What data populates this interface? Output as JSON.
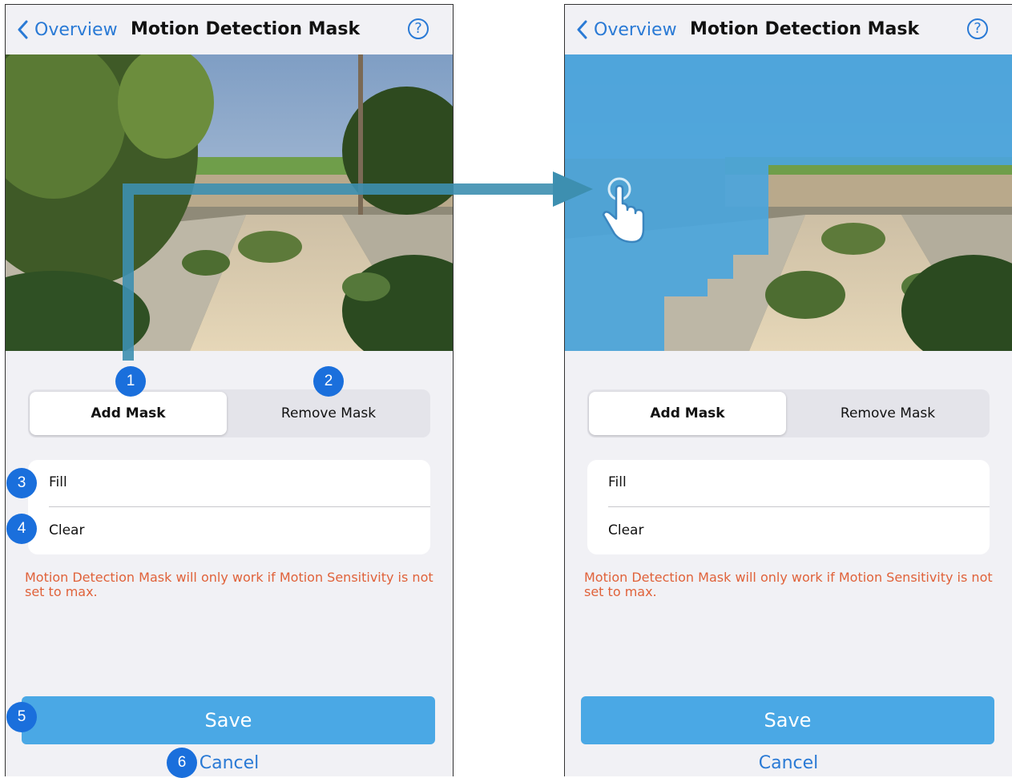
{
  "nav": {
    "back_label": "Overview",
    "title": "Motion Detection Mask",
    "help_glyph": "?"
  },
  "segments": {
    "add_mask": "Add Mask",
    "remove_mask": "Remove Mask"
  },
  "options": {
    "fill": "Fill",
    "clear": "Clear"
  },
  "warning": "Motion Detection Mask will only work if Motion Sensitivity is not set to max.",
  "actions": {
    "save": "Save",
    "cancel": "Cancel"
  },
  "callouts": [
    "1",
    "2",
    "3",
    "4",
    "5",
    "6"
  ],
  "colors": {
    "accent": "#2a7ad5",
    "button": "#4aa8e5",
    "warning": "#e0623a",
    "badge": "#1a6fdc",
    "mask_overlay": "#4ba5dc",
    "arrow": "#3d8fb0"
  }
}
